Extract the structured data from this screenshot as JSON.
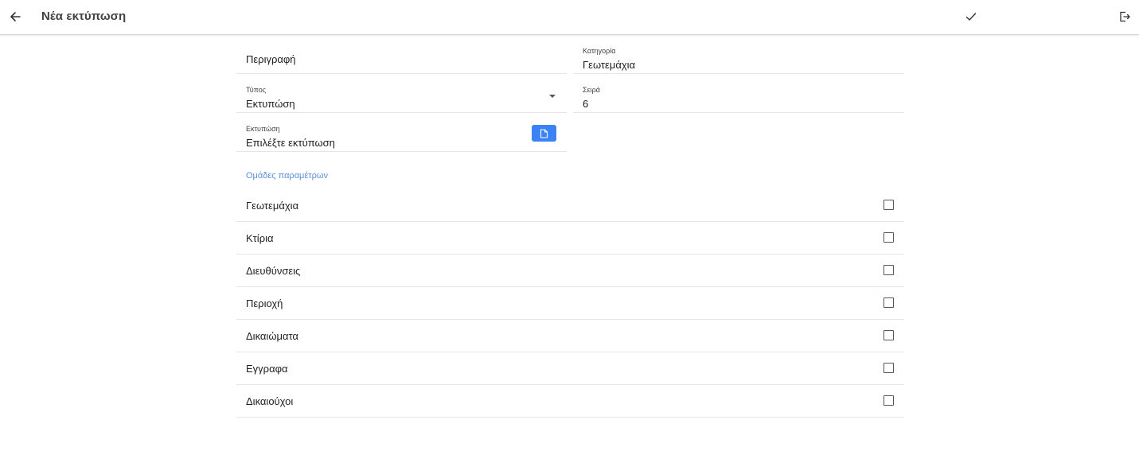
{
  "header": {
    "title": "Νέα εκτύπωση",
    "back_icon": "arrow-left-icon",
    "save_icon": "check-icon",
    "exit_icon": "logout-icon"
  },
  "form": {
    "description": {
      "placeholder": "Περιγραφή"
    },
    "category": {
      "label": "Κατηγορία",
      "value": "Γεωτεμάχια"
    },
    "type": {
      "label": "Τύπος",
      "value": "Εκτυπώση"
    },
    "order": {
      "label": "Σειρά",
      "value": "6"
    },
    "print": {
      "label": "Εκτυπώση",
      "value": "Επιλέξτε εκτύπωση",
      "button_icon": "file-icon"
    }
  },
  "param_groups": {
    "title": "Ομάδες παραμέτρων",
    "items": [
      {
        "label": "Γεωτεμάχια",
        "checked": false
      },
      {
        "label": "Κτίρια",
        "checked": false
      },
      {
        "label": "Διευθύνσεις",
        "checked": false
      },
      {
        "label": "Περιοχή",
        "checked": false
      },
      {
        "label": "Δικαιώματα",
        "checked": false
      },
      {
        "label": "Εγγραφα",
        "checked": false
      },
      {
        "label": "Δικαιούχοι",
        "checked": false
      }
    ]
  },
  "colors": {
    "accent": "#3b82f6",
    "section_title": "#5b8fd6"
  }
}
